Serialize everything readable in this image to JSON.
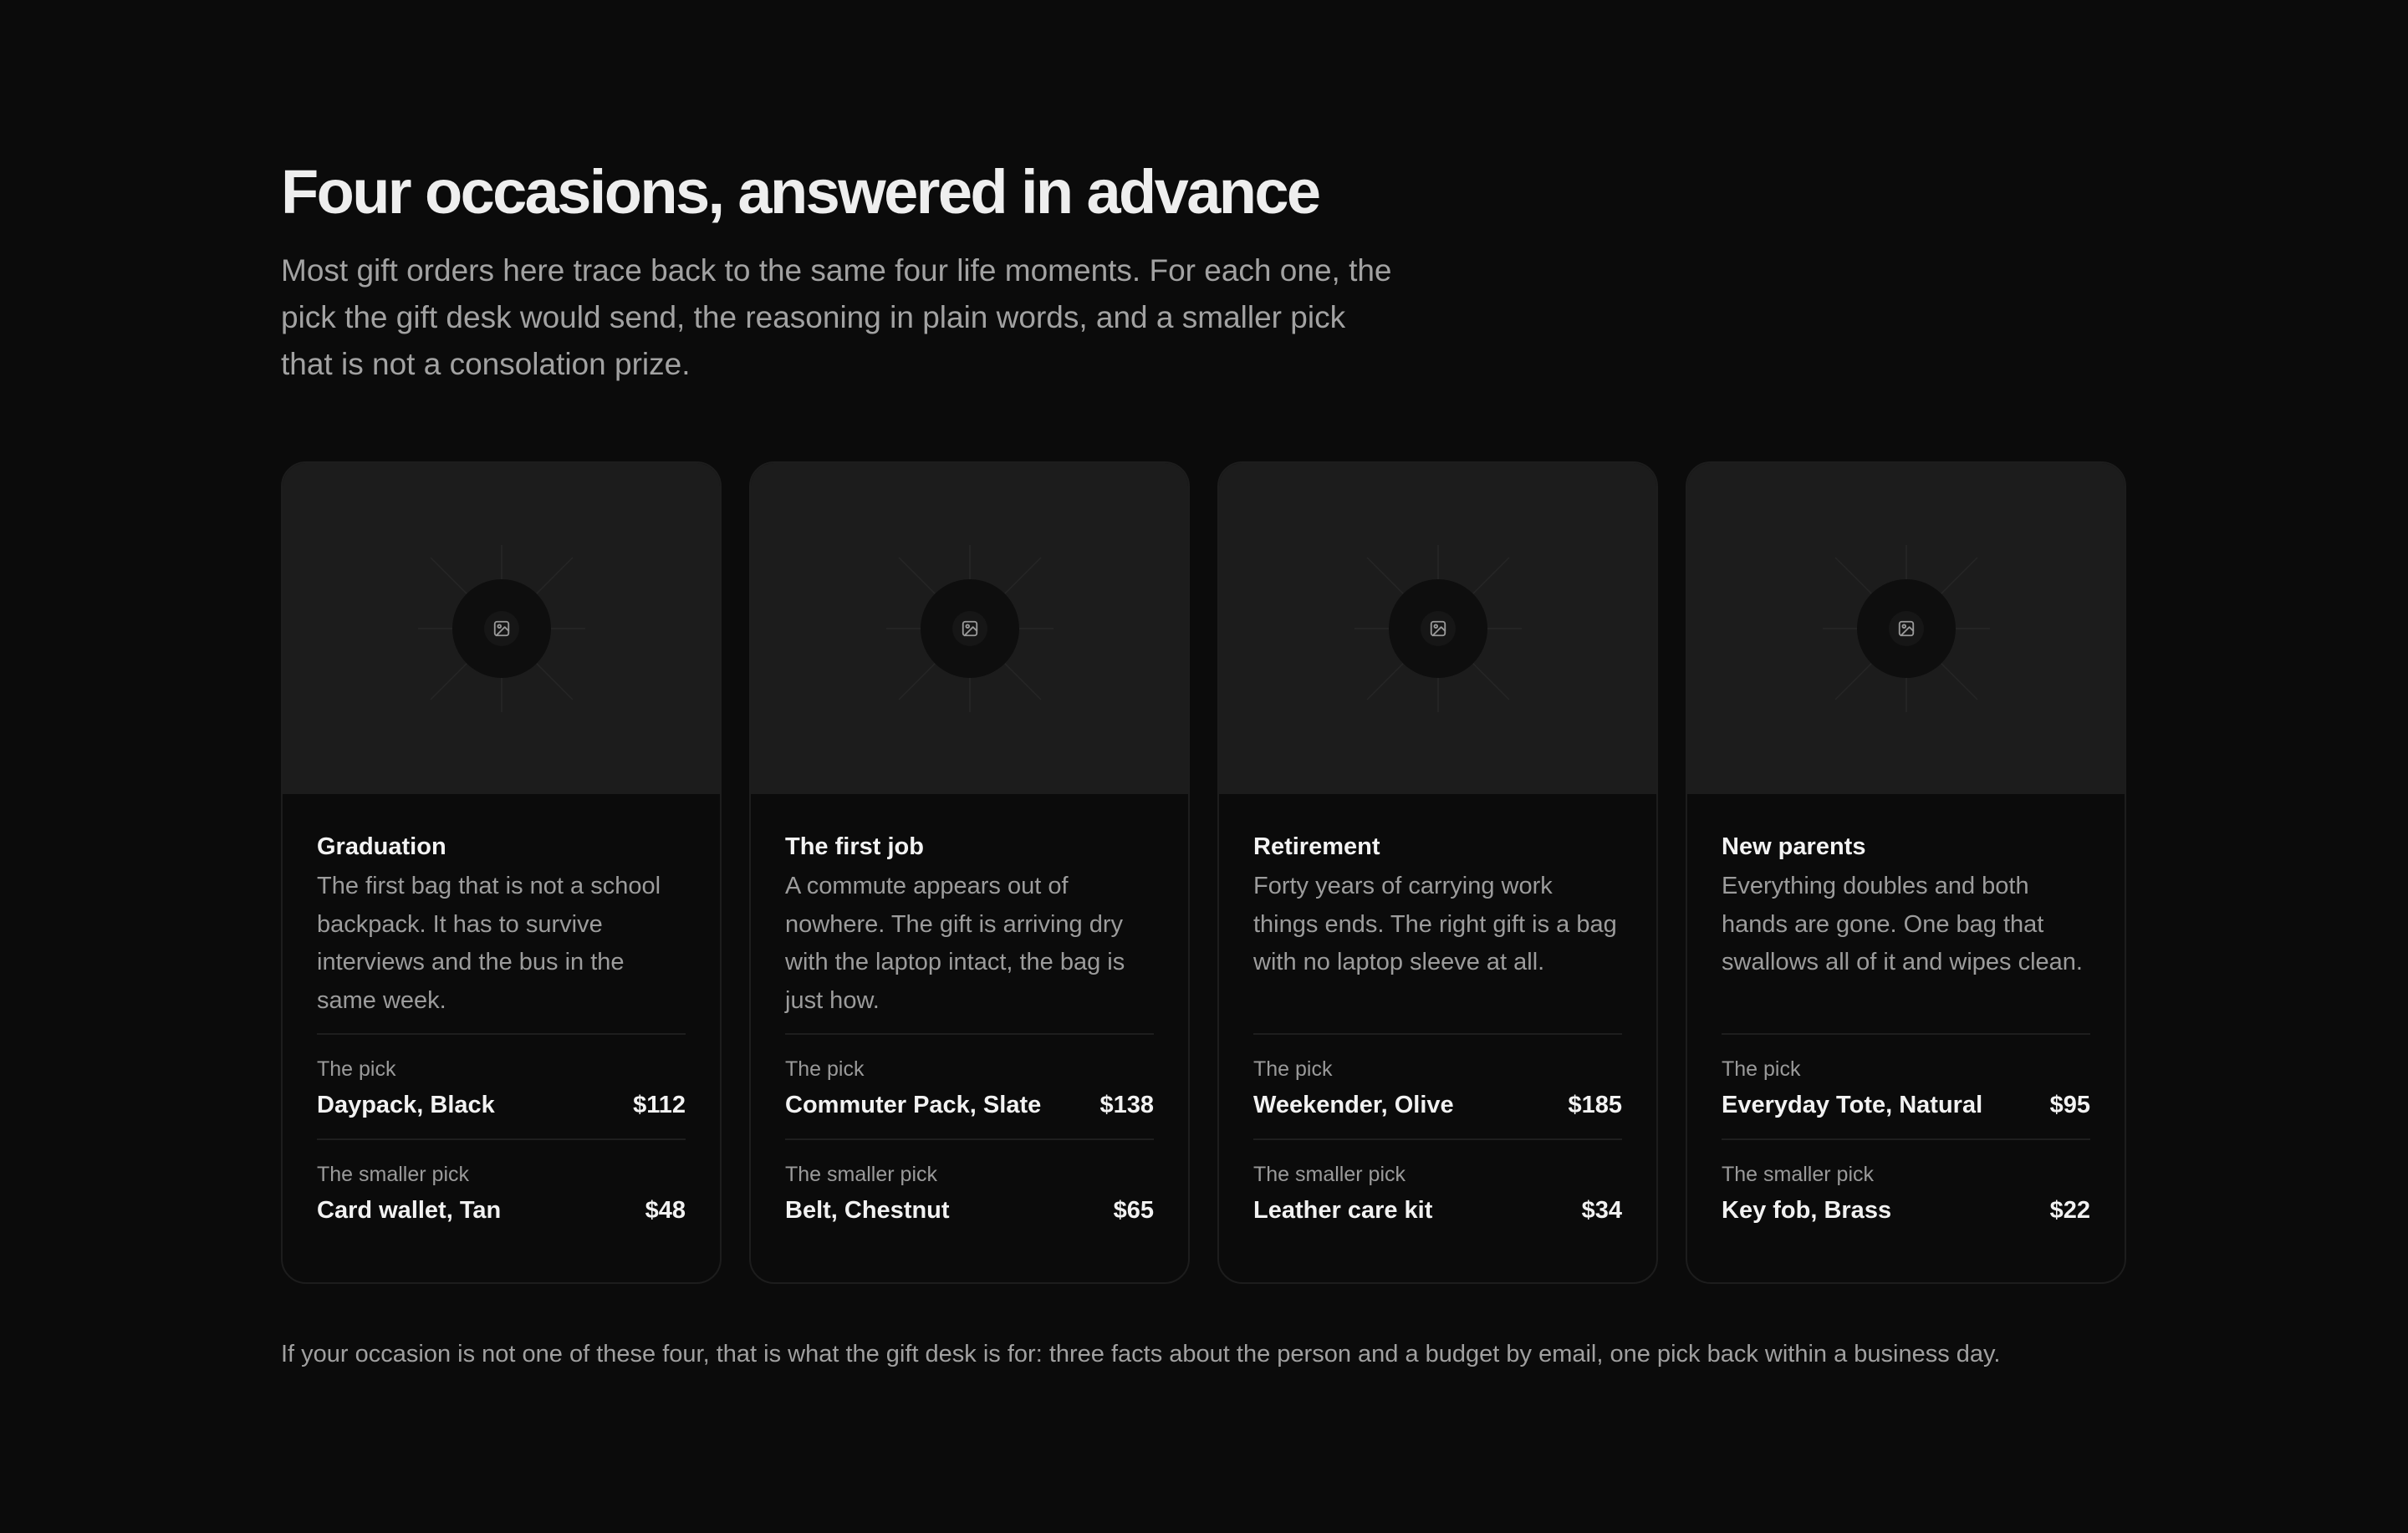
{
  "header": {
    "title": "Four occasions, answered in advance",
    "intro": "Most gift orders here trace back to the same four life moments. For each one, the pick the gift desk would send, the reasoning in plain words, and a smaller pick that is not a consolation prize."
  },
  "cards": [
    {
      "title": "Graduation",
      "description": "The first bag that is not a school backpack. It has to survive interviews and the bus in the same week.",
      "pick_label": "The pick",
      "pick_name": "Daypack, Black",
      "pick_price": "$112",
      "smaller_label": "The smaller pick",
      "smaller_name": "Card wallet, Tan",
      "smaller_price": "$48",
      "image_icon": "image-placeholder-icon"
    },
    {
      "title": "The first job",
      "description": "A commute appears out of nowhere. The gift is arriving dry with the laptop intact, the bag is just how.",
      "pick_label": "The pick",
      "pick_name": "Commuter Pack, Slate",
      "pick_price": "$138",
      "smaller_label": "The smaller pick",
      "smaller_name": "Belt, Chestnut",
      "smaller_price": "$65",
      "image_icon": "image-placeholder-icon"
    },
    {
      "title": "Retirement",
      "description": "Forty years of carrying work things ends. The right gift is a bag with no laptop sleeve at all.",
      "pick_label": "The pick",
      "pick_name": "Weekender, Olive",
      "pick_price": "$185",
      "smaller_label": "The smaller pick",
      "smaller_name": "Leather care kit",
      "smaller_price": "$34",
      "image_icon": "image-placeholder-icon"
    },
    {
      "title": "New parents",
      "description": "Everything doubles and both hands are gone. One bag that swallows all of it and wipes clean.",
      "pick_label": "The pick",
      "pick_name": "Everyday Tote, Natural",
      "pick_price": "$95",
      "smaller_label": "The smaller pick",
      "smaller_name": "Key fob, Brass",
      "smaller_price": "$22",
      "image_icon": "image-placeholder-icon"
    }
  ],
  "footnote": "If your occasion is not one of these four, that is what the gift desk is for: three facts about the person and a budget by email, one pick back within a business day.",
  "colors": {
    "background": "#0b0b0b",
    "card_image_bg": "#1c1c1c",
    "text_primary": "#f2f2f2",
    "text_muted": "#9c9c9c"
  }
}
